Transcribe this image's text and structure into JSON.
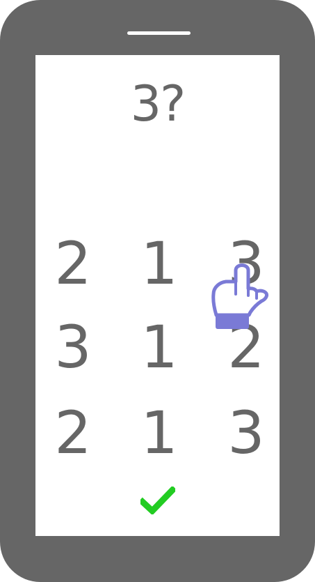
{
  "question": {
    "text": "3?"
  },
  "grid": {
    "rows": [
      [
        "2",
        "1",
        "3"
      ],
      [
        "3",
        "1",
        "2"
      ],
      [
        "2",
        "1",
        "3"
      ]
    ]
  },
  "icons": {
    "confirm": "check-icon",
    "pointer": "pointing-hand-icon"
  },
  "colors": {
    "frame": "#666666",
    "screen": "#ffffff",
    "text": "#666666",
    "confirm": "#22cc22",
    "hand_outline": "#7a7ad6",
    "hand_cuff": "#7a7ad6"
  }
}
